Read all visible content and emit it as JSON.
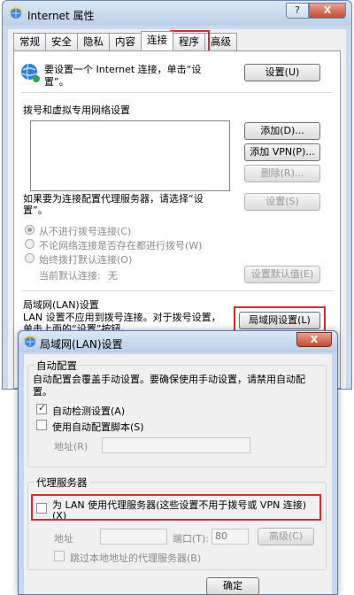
{
  "main_window": {
    "title": "Internet 属性",
    "help_label": "?",
    "close_label": "X",
    "tabs": [
      "常规",
      "安全",
      "隐私",
      "内容",
      "连接",
      "程序",
      "高级"
    ],
    "setup_text": "要设置一个 Internet 连接，单击“设置”。",
    "setup_button": "设置(U)",
    "dialup_title": "拨号和虚拟专用网络设置",
    "add_button": "添加(D)...",
    "add_vpn_button": "添加 VPN(P)...",
    "remove_button": "删除(R)...",
    "proxy_hint": "如果要为连接配置代理服务器，请选择“设置”。",
    "settings_button": "设置(S)",
    "radio_options": [
      "从不进行拨号连接(C)",
      "不论网络连接是否存在都进行拨号(W)",
      "始终拨打默认连接(O)"
    ],
    "current_default_label": "当前默认连接:",
    "current_default_value": "无",
    "set_default_button": "设置默认值(E)",
    "lan_title": "局域网(LAN)设置",
    "lan_text": "LAN 设置不应用到拨号连接。对于拨号设置，单击上面的“设置”按钮。",
    "lan_button": "局域网设置(L)"
  },
  "lan_dialog": {
    "title": "局域网(LAN)设置",
    "close_label": "X",
    "auto_config_title": "自动配置",
    "auto_config_desc": "自动配置会覆盖手动设置。要确保使用手动设置，请禁用自动配置。",
    "auto_detect_label": "自动检测设置(A)",
    "auto_detect_checked": true,
    "use_script_label": "使用自动配置脚本(S)",
    "use_script_checked": false,
    "address_label": "地址(R)",
    "proxy_title": "代理服务器",
    "use_proxy_label": "为 LAN 使用代理服务器(这些设置不用于拨号或 VPN 连接)(X)",
    "use_proxy_checked": false,
    "proxy_address_label": "地址",
    "port_label": "端口(T):",
    "port_value": "80",
    "advanced_button": "高级(C)",
    "bypass_label": "跳过本地地址的代理服务器(B)",
    "ok_button": "确定"
  },
  "colors": {
    "highlight": "#e1262c",
    "title_bg": "#c9daee"
  }
}
